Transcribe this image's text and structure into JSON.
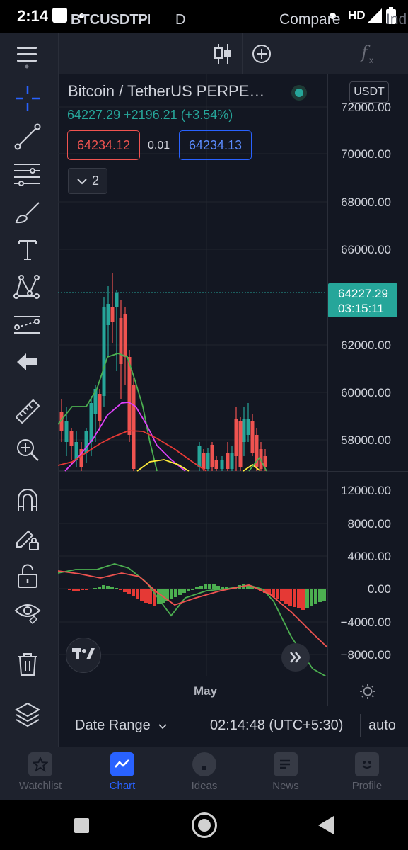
{
  "status_bar": {
    "time": "2:14",
    "network": "HD"
  },
  "toolbar": {
    "symbol": "BTCUSDTPE",
    "interval": "D",
    "compare_label": "Compare",
    "indicators_label": "Ind"
  },
  "left_toolbar": {
    "icons": [
      "menu-icon",
      "crosshair-icon",
      "trend-line-icon",
      "fib-icon",
      "brush-icon",
      "text-icon",
      "pattern-icon",
      "forecast-icon",
      "back-arrow-icon",
      "ruler-icon",
      "zoom-in-icon",
      "magnet-icon",
      "lock-drawing-icon",
      "unlock-icon",
      "eye-icon",
      "trash-icon",
      "layers-icon"
    ]
  },
  "legend": {
    "title": "Bitcoin / TetherUS PERPE…",
    "last": "64227.29",
    "change": "+2196.21",
    "change_pct": "(+3.54%)",
    "sell_price": "64234.12",
    "spread": "0.01",
    "buy_price": "64234.13",
    "collapsed_count": "2"
  },
  "price_axis": {
    "currency": "USDT",
    "ticks": [
      "72000.00",
      "70000.00",
      "68000.00",
      "66000.00",
      "62000.00",
      "60000.00",
      "58000.00"
    ],
    "last_price_label": "64227.29",
    "countdown": "03:15:11"
  },
  "indicator_axis": {
    "ticks": [
      "12000.00",
      "8000.00",
      "4000.00",
      "0.00",
      "−4000.00",
      "−8000.00"
    ]
  },
  "time_axis": {
    "label": "May"
  },
  "info_bar": {
    "date_range": "Date Range",
    "timezone": "02:14:48 (UTC+5:30)",
    "autoscale": "auto"
  },
  "bottom_nav": {
    "items": [
      {
        "label": "Watchlist",
        "icon": "star-icon",
        "active": false
      },
      {
        "label": "Chart",
        "icon": "chart-icon",
        "active": true
      },
      {
        "label": "Ideas",
        "icon": "lightbulb-icon",
        "active": false
      },
      {
        "label": "News",
        "icon": "news-icon",
        "active": false
      },
      {
        "label": "Profile",
        "icon": "smiley-icon",
        "active": false
      }
    ]
  },
  "colors": {
    "background": "#131722",
    "panel": "#1e222d",
    "up": "#26a69a",
    "down": "#ef5350",
    "accent": "#2962ff"
  }
}
